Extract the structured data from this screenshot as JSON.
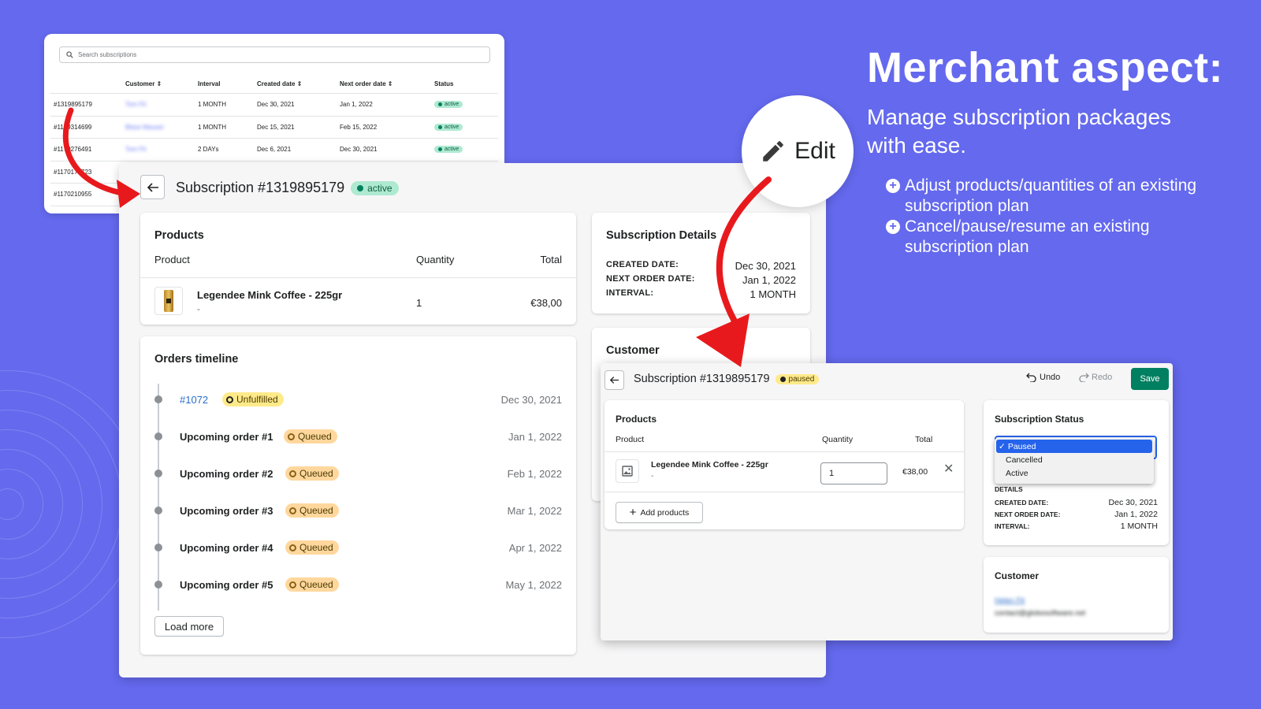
{
  "colors": {
    "background": "#6469ee",
    "accent_green": "#008060",
    "active_badge": "#aee9d1",
    "queued_badge": "#ffd79d",
    "unfulfilled_badge": "#ffea8a",
    "arrow_red": "#e8191c",
    "link_blue": "#2c6ecb"
  },
  "headline": {
    "title": "Merchant aspect:",
    "subtitle": "Manage subscription packages with ease.",
    "bullets": [
      "Adjust products/quantities of an existing subscription plan",
      "Cancel/pause/resume an existing subscription plan"
    ]
  },
  "edit_bubble": {
    "label": "Edit",
    "icon": "pencil-icon"
  },
  "list": {
    "search_placeholder": "Search subscriptions",
    "headers": [
      "Customer",
      "Interval",
      "Created date",
      "Next order date",
      "Status"
    ],
    "rows": [
      {
        "id": "#1319895179",
        "customer": "Tom Fit",
        "interval": "1 MONTH",
        "created": "Dec 30, 2021",
        "next": "Jan 1, 2022",
        "status": "active"
      },
      {
        "id": "#1189314699",
        "customer": "Blaze Mauser",
        "interval": "1 MONTH",
        "created": "Dec 15, 2021",
        "next": "Feb 15, 2022",
        "status": "active"
      },
      {
        "id": "#1170276491",
        "customer": "Tom Fit",
        "interval": "2 DAYs",
        "created": "Dec 6, 2021",
        "next": "Dec 30, 2021",
        "status": "active"
      },
      {
        "id": "#1170173723"
      },
      {
        "id": "#1170210955"
      }
    ]
  },
  "detail": {
    "title": "Subscription #1319895179",
    "status": "active",
    "products": {
      "title": "Products",
      "col_product": "Product",
      "col_quantity": "Quantity",
      "col_total": "Total",
      "item": {
        "name": "Legendee Mink Coffee - 225gr",
        "variant": "-",
        "quantity": "1",
        "total": "€38,00"
      }
    },
    "details": {
      "title": "Subscription Details",
      "created_label": "CREATED DATE:",
      "created": "Dec 30, 2021",
      "next_label": "NEXT ORDER DATE:",
      "next": "Jan 1, 2022",
      "interval_label": "INTERVAL:",
      "interval": "1 MONTH"
    },
    "customer_title": "Customer",
    "timeline": {
      "title": "Orders timeline",
      "items": [
        {
          "label": "#1072",
          "badge": "Unfulfilled",
          "date": "Dec 30, 2021"
        },
        {
          "label": "Upcoming order #1",
          "badge": "Queued",
          "date": "Jan 1, 2022"
        },
        {
          "label": "Upcoming order #2",
          "badge": "Queued",
          "date": "Feb 1, 2022"
        },
        {
          "label": "Upcoming order #3",
          "badge": "Queued",
          "date": "Mar 1, 2022"
        },
        {
          "label": "Upcoming order #4",
          "badge": "Queued",
          "date": "Apr 1, 2022"
        },
        {
          "label": "Upcoming order #5",
          "badge": "Queued",
          "date": "May 1, 2022"
        }
      ],
      "load_more": "Load more"
    }
  },
  "edit": {
    "title": "Subscription #1319895179",
    "status": "paused",
    "undo": "Undo",
    "redo": "Redo",
    "save": "Save",
    "products": {
      "title": "Products",
      "col_product": "Product",
      "col_quantity": "Quantity",
      "col_total": "Total",
      "item": {
        "name": "Legendee Mink Coffee - 225gr",
        "variant": "-",
        "quantity": "1",
        "total": "€38,00"
      },
      "add_button": "Add products"
    },
    "status_card": {
      "title": "Subscription Status",
      "options": [
        "Paused",
        "Cancelled",
        "Active"
      ],
      "selected": "Paused",
      "details_label": "DETAILS",
      "created_label": "CREATED DATE:",
      "created": "Dec 30, 2021",
      "next_label": "NEXT ORDER DATE:",
      "next": "Jan 1, 2022",
      "interval_label": "INTERVAL:",
      "interval": "1 MONTH"
    },
    "customer": {
      "title": "Customer",
      "name": "Helen Fit",
      "email": "contact@globosoftware.net"
    }
  }
}
